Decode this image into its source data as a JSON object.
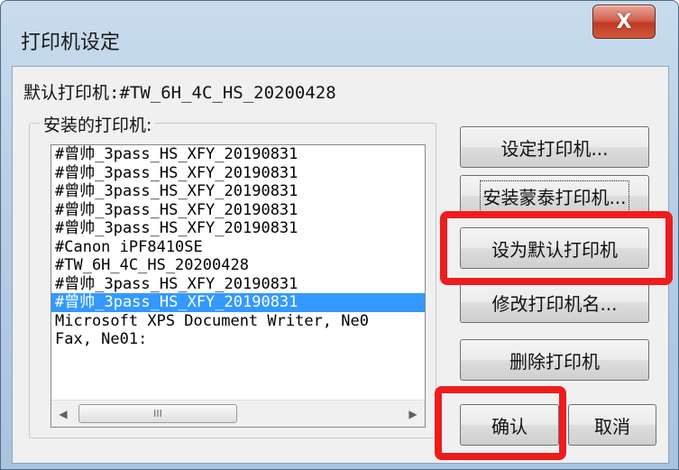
{
  "window": {
    "title": "打印机设定",
    "close_glyph": "X"
  },
  "default_printer": "默认打印机:#TW_6H_4C_HS_20200428",
  "installed_label": "安装的打印机:",
  "printers": [
    "#曾帅_3pass_HS_XFY_20190831",
    "#曾帅_3pass_HS_XFY_20190831",
    "#曾帅_3pass_HS_XFY_20190831",
    "#曾帅_3pass_HS_XFY_20190831",
    "#曾帅_3pass_HS_XFY_20190831",
    "#Canon iPF8410SE",
    "#TW_6H_4C_HS_20200428",
    "#曾帅_3pass_HS_XFY_20190831",
    "#曾帅_3pass_HS_XFY_20190831",
    "Microsoft XPS Document Writer, Ne0",
    "Fax, Ne01:"
  ],
  "selected_index": 8,
  "scrollbar": {
    "left_glyph": "◀",
    "right_glyph": "▶",
    "thumb_grip": "III"
  },
  "buttons": {
    "set_printer": "设定打印机...",
    "install_mengtai": "安装蒙泰打印机...",
    "set_default": "设为默认打印机",
    "rename": "修改打印机名...",
    "delete": "删除打印机",
    "ok": "确认",
    "cancel": "取消"
  },
  "colors": {
    "highlight": "#ee1c1c",
    "selection": "#3399ff"
  }
}
